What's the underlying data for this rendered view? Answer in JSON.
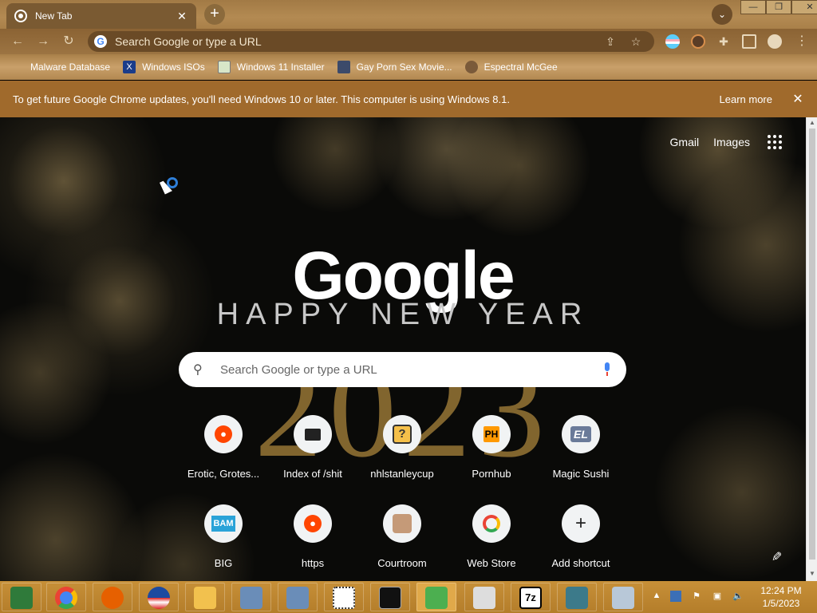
{
  "tab": {
    "title": "New Tab"
  },
  "window_controls": {
    "minimize": "—",
    "restore": "❐",
    "close": "✕"
  },
  "omnibox": {
    "placeholder": "Search Google or type a URL"
  },
  "bookmarks": [
    {
      "label": "Malware Database",
      "icon": "skull-icon"
    },
    {
      "label": "Windows ISOs",
      "icon": "x-icon"
    },
    {
      "label": "Windows 11 Installer",
      "icon": "image-icon"
    },
    {
      "label": "Gay Porn Sex Movie...",
      "icon": "globe-icon"
    },
    {
      "label": "Espectral McGee",
      "icon": "avatar-icon"
    }
  ],
  "infobar": {
    "message": "To get future Google Chrome updates, you'll need Windows 10 or later. This computer is using Windows 8.1.",
    "learn_more": "Learn more"
  },
  "ntp": {
    "gmail": "Gmail",
    "images": "Images",
    "logo": "Google",
    "doodle_line1": "HAPPY NEW YEAR",
    "doodle_line2": "2023",
    "search_placeholder": "Search Google or type a URL"
  },
  "shortcuts": [
    {
      "label": "Erotic, Grotes...",
      "icon": "reddit-icon"
    },
    {
      "label": "Index of /shit",
      "icon": "folder-icon"
    },
    {
      "label": "nhlstanleycup",
      "icon": "question-block-icon"
    },
    {
      "label": "Pornhub",
      "icon": "ph-icon",
      "glyph": "PH"
    },
    {
      "label": "Magic Sushi",
      "icon": "el-icon",
      "glyph": "EL"
    },
    {
      "label": "BIG",
      "icon": "bam-icon",
      "glyph": "BAM"
    },
    {
      "label": "https",
      "icon": "reddit-icon"
    },
    {
      "label": "Courtroom",
      "icon": "face-icon"
    },
    {
      "label": "Web Store",
      "icon": "chrome-webstore-icon"
    },
    {
      "label": "Add shortcut",
      "icon": "plus-icon"
    }
  ],
  "taskbar": {
    "clock_time": "12:24 PM",
    "clock_date": "1/5/2023",
    "items": [
      "file-manager-icon",
      "chrome-icon",
      "firefox-icon",
      "obama-logo-icon",
      "folder-icon",
      "network-icon",
      "network-icon",
      "pixel-art-icon",
      "terminal-icon",
      "people-icon",
      "printer-icon",
      "7zip-icon",
      "installer-icon",
      "display-icon"
    ]
  },
  "colors": {
    "infobar": "#a06a2c",
    "taskbar": "#c79038",
    "accent_blue": "#4285f4",
    "reddit": "#ff4500"
  }
}
